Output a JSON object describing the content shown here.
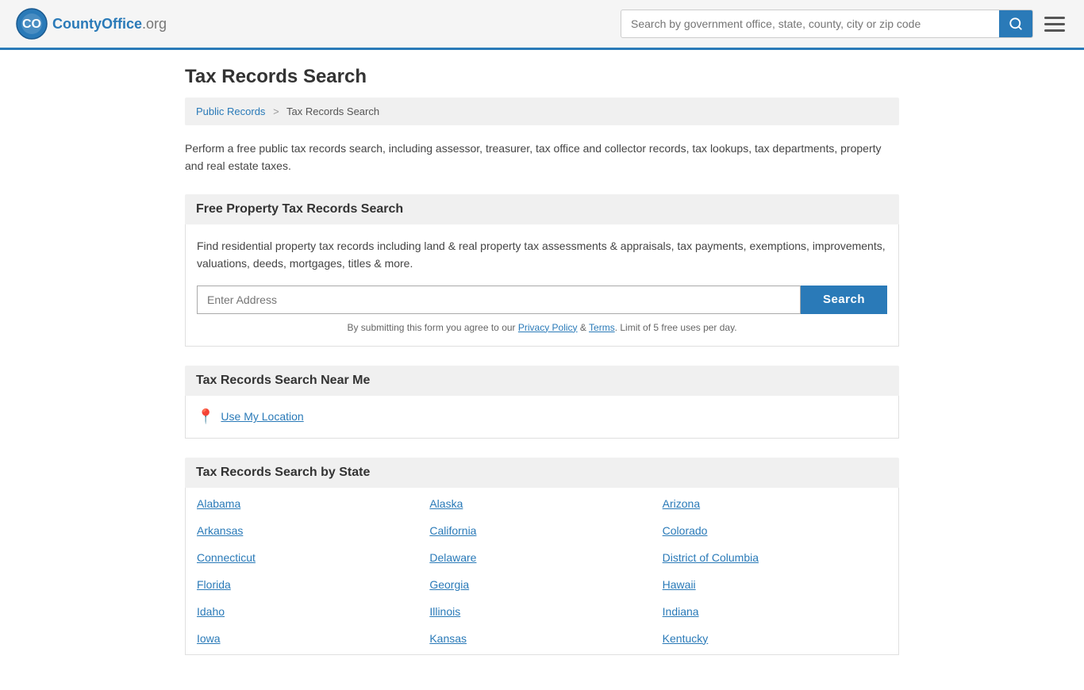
{
  "site": {
    "logo_text": "CountyOffice",
    "logo_org": ".org"
  },
  "header": {
    "search_placeholder": "Search by government office, state, county, city or zip code",
    "menu_label": "Menu"
  },
  "page": {
    "title": "Tax Records Search",
    "intro": "Perform a free public tax records search, including assessor, treasurer, tax office and collector records, tax lookups, tax departments, property and real estate taxes."
  },
  "breadcrumb": {
    "parent_label": "Public Records",
    "separator": ">",
    "current_label": "Tax Records Search"
  },
  "property_search": {
    "heading": "Free Property Tax Records Search",
    "description": "Find residential property tax records including land & real property tax assessments & appraisals, tax payments, exemptions, improvements, valuations, deeds, mortgages, titles & more.",
    "input_placeholder": "Enter Address",
    "search_button": "Search",
    "disclaimer_prefix": "By submitting this form you agree to our ",
    "privacy_label": "Privacy Policy",
    "and": " & ",
    "terms_label": "Terms",
    "disclaimer_suffix": ". Limit of 5 free uses per day."
  },
  "near_me": {
    "heading": "Tax Records Search Near Me",
    "use_location_label": "Use My Location"
  },
  "state_search": {
    "heading": "Tax Records Search by State",
    "states": [
      {
        "label": "Alabama",
        "col": 0
      },
      {
        "label": "Alaska",
        "col": 1
      },
      {
        "label": "Arizona",
        "col": 2
      },
      {
        "label": "Arkansas",
        "col": 0
      },
      {
        "label": "California",
        "col": 1
      },
      {
        "label": "Colorado",
        "col": 2
      },
      {
        "label": "Connecticut",
        "col": 0
      },
      {
        "label": "Delaware",
        "col": 1
      },
      {
        "label": "District of Columbia",
        "col": 2
      },
      {
        "label": "Florida",
        "col": 0
      },
      {
        "label": "Georgia",
        "col": 1
      },
      {
        "label": "Hawaii",
        "col": 2
      },
      {
        "label": "Idaho",
        "col": 0
      },
      {
        "label": "Illinois",
        "col": 1
      },
      {
        "label": "Indiana",
        "col": 2
      },
      {
        "label": "Iowa",
        "col": 0
      },
      {
        "label": "Kansas",
        "col": 1
      },
      {
        "label": "Kentucky",
        "col": 2
      }
    ]
  }
}
